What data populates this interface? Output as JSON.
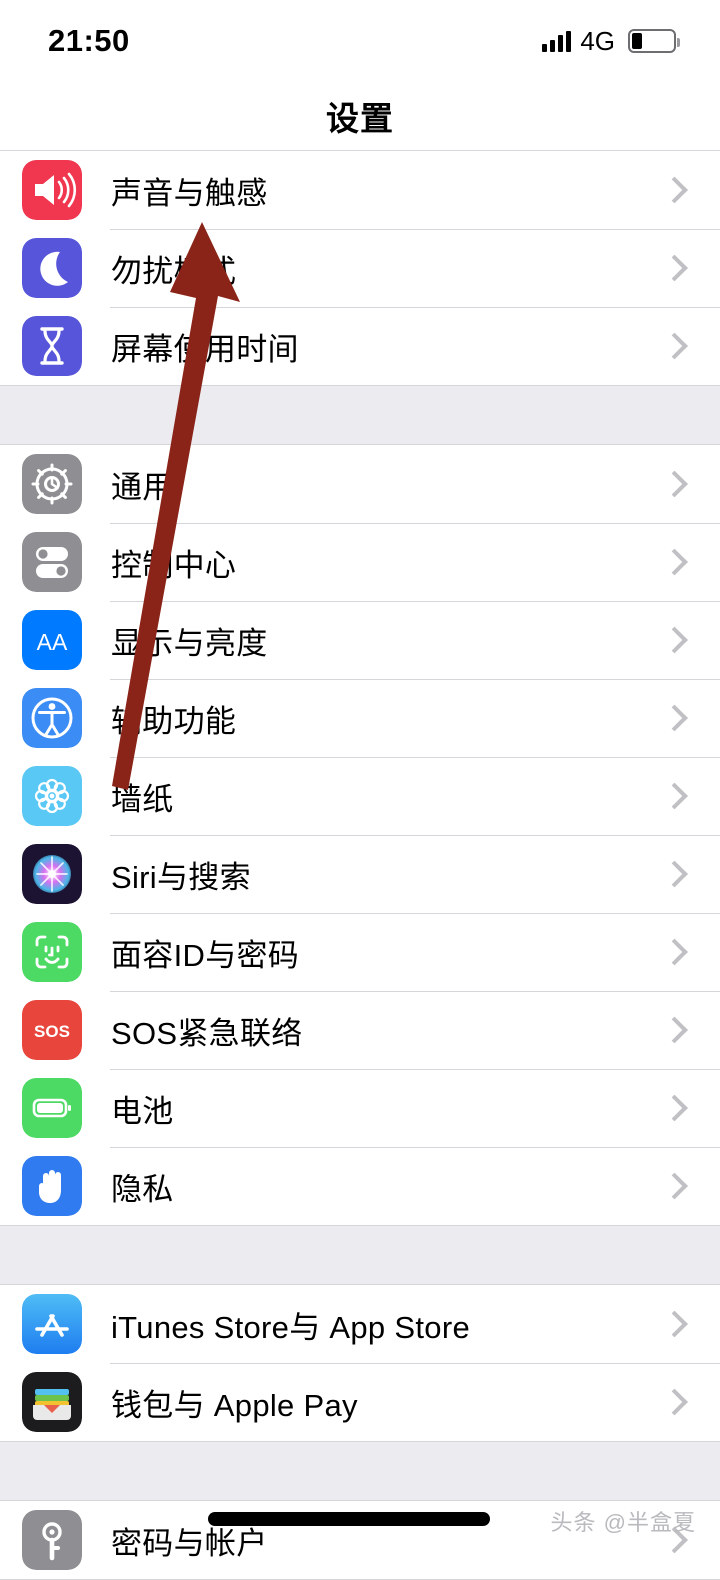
{
  "status_bar": {
    "time": "21:50",
    "carrier_network": "4G",
    "signal_bars": 4,
    "battery_level_percent": 25,
    "icons": [
      "signal-bars-icon",
      "battery-icon"
    ]
  },
  "header": {
    "title": "设置"
  },
  "colors": {
    "separator_band": "#ebebf0",
    "hairline": "#d6d6da",
    "chevron": "#c1c1c5",
    "annotation_arrow": "#8b2418",
    "watermark": "#b9b9be",
    "blue": "#007aff",
    "green": "#4cd964",
    "red": "#e8453c",
    "pink": "#f0374f",
    "purple": "#5755d9",
    "gray": "#8e8e93",
    "lightblue": "#5ac8f5"
  },
  "groups": [
    {
      "name": "group-sound",
      "rows": [
        {
          "label": "声音与触感",
          "icon": "sound-haptics-icon",
          "accessory": "chevron-right-icon"
        },
        {
          "label": "勿扰模式",
          "icon": "do-not-disturb-icon",
          "accessory": "chevron-right-icon"
        },
        {
          "label": "屏幕使用时间",
          "icon": "screen-time-icon",
          "accessory": "chevron-right-icon"
        }
      ]
    },
    {
      "name": "group-general",
      "rows": [
        {
          "label": "通用",
          "icon": "general-gear-icon",
          "accessory": "chevron-right-icon"
        },
        {
          "label": "控制中心",
          "icon": "control-center-icon",
          "accessory": "chevron-right-icon"
        },
        {
          "label": "显示与亮度",
          "icon": "display-brightness-icon",
          "accessory": "chevron-right-icon"
        },
        {
          "label": "辅助功能",
          "icon": "accessibility-icon",
          "accessory": "chevron-right-icon"
        },
        {
          "label": "墙纸",
          "icon": "wallpaper-icon",
          "accessory": "chevron-right-icon"
        },
        {
          "label": "Siri与搜索",
          "icon": "siri-search-icon",
          "accessory": "chevron-right-icon"
        },
        {
          "label": "面容ID与密码",
          "icon": "face-id-passcode-icon",
          "accessory": "chevron-right-icon"
        },
        {
          "label": "SOS紧急联络",
          "icon": "emergency-sos-icon",
          "accessory": "chevron-right-icon"
        },
        {
          "label": "电池",
          "icon": "battery-settings-icon",
          "accessory": "chevron-right-icon"
        },
        {
          "label": "隐私",
          "icon": "privacy-hand-icon",
          "accessory": "chevron-right-icon"
        }
      ]
    },
    {
      "name": "group-store",
      "rows": [
        {
          "label": "iTunes Store与 App Store",
          "icon": "app-store-icon",
          "accessory": "chevron-right-icon"
        },
        {
          "label": "钱包与 Apple Pay",
          "icon": "wallet-icon",
          "accessory": "chevron-right-icon"
        }
      ]
    },
    {
      "name": "group-accounts",
      "rows": [
        {
          "label": "密码与帐户",
          "icon": "passwords-accounts-icon",
          "accessory": "chevron-right-icon"
        }
      ]
    }
  ],
  "annotations": {
    "arrow": {
      "name": "upward-pointing-arrow",
      "color": "#8b2418",
      "points_to": "勿扰模式"
    },
    "redaction_bar": {
      "name": "redaction-bar"
    },
    "watermark": {
      "text": "头条 @半盒夏"
    }
  }
}
